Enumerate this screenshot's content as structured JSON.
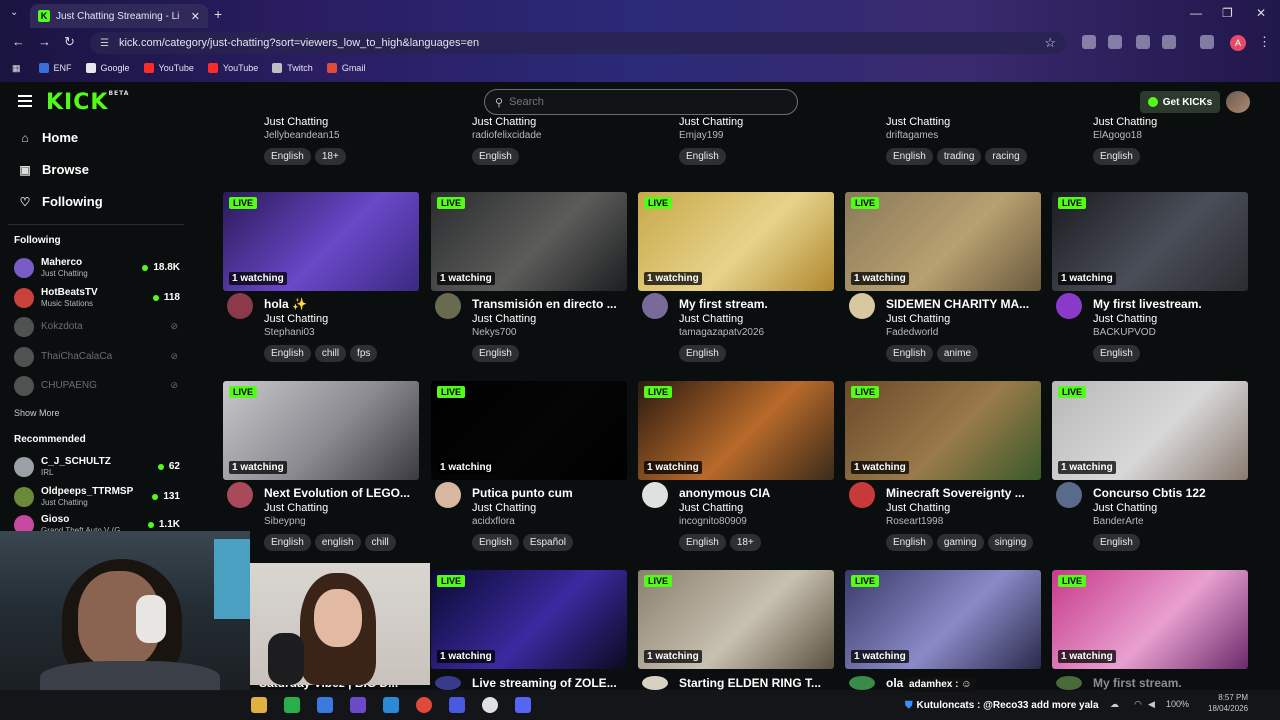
{
  "browser": {
    "tab_title": "Just Chatting Streaming - Li",
    "url": "kick.com/category/just-chatting?sort=viewers_low_to_high&languages=en",
    "bookmarks": [
      {
        "label": "ENF",
        "color": "#3b6fd8"
      },
      {
        "label": "Google",
        "color": "#e8e8e8"
      },
      {
        "label": "YouTube",
        "color": "#ff2a2a"
      },
      {
        "label": "YouTube",
        "color": "#ff2a2a"
      },
      {
        "label": "Twitch",
        "color": "#c0c0c0"
      },
      {
        "label": "Gmail",
        "color": "#e04a3a"
      }
    ],
    "profile_initial": "A"
  },
  "header": {
    "logo": "KICK",
    "logo_sup": "BETA",
    "search_placeholder": "Search",
    "get_kicks": "Get KICKs"
  },
  "sidebar": {
    "nav": [
      {
        "label": "Home",
        "icon": "home-icon",
        "glyph": "⌂"
      },
      {
        "label": "Browse",
        "icon": "browse-icon",
        "glyph": "▣"
      },
      {
        "label": "Following",
        "icon": "heart-icon",
        "glyph": "♡"
      }
    ],
    "following_title": "Following",
    "following": [
      {
        "name": "Maherco",
        "category": "Just Chatting",
        "viewers": "18.8K",
        "online": true,
        "color": "#7a5cc8"
      },
      {
        "name": "HotBeatsTV",
        "category": "Music Stations",
        "viewers": "118",
        "online": true,
        "color": "#c8413a"
      },
      {
        "name": "Kokzdota",
        "category": "",
        "viewers": "",
        "online": false,
        "color": "#8a8a8a"
      },
      {
        "name": "ThaiChaCalaCa",
        "category": "",
        "viewers": "",
        "online": false,
        "color": "#8a8a8a"
      },
      {
        "name": "CHUPAENG",
        "category": "",
        "viewers": "",
        "online": false,
        "color": "#8a8a8a"
      }
    ],
    "show_more": "Show More",
    "recommended_title": "Recommended",
    "recommended": [
      {
        "name": "C_J_SCHULTZ",
        "category": "IRL",
        "viewers": "62",
        "color": "#9aa0a6"
      },
      {
        "name": "Oldpeeps_TTRMSP",
        "category": "Just Chatting",
        "viewers": "131",
        "color": "#6a8a3a"
      },
      {
        "name": "Gioso",
        "category": "Grand Theft Auto V (G",
        "viewers": "1.1K",
        "color": "#c84aa0"
      }
    ]
  },
  "top_row": [
    {
      "category": "Just Chatting",
      "user": "Jellybeandean15",
      "tags": [
        "English",
        "18+"
      ]
    },
    {
      "category": "Just Chatting",
      "user": "radiofelixcidade",
      "tags": [
        "English"
      ]
    },
    {
      "category": "Just Chatting",
      "user": "Emjay199",
      "tags": [
        "English"
      ]
    },
    {
      "category": "Just Chatting",
      "user": "driftagames",
      "tags": [
        "English",
        "trading",
        "racing"
      ]
    },
    {
      "category": "Just Chatting",
      "user": "ElAgogo18",
      "tags": [
        "English"
      ]
    }
  ],
  "rows": [
    [
      {
        "title": "hola ✨",
        "category": "Just Chatting",
        "user": "Stephani03",
        "tags": [
          "English",
          "chill",
          "fps"
        ],
        "watching": "1 watching",
        "thumb": [
          "#2a1a5a",
          "#6a48c8",
          "#3a2a80"
        ],
        "avatar": "#8a3a4a"
      },
      {
        "title": "Transmisión en directo ...",
        "category": "Just Chatting",
        "user": "Nekys700",
        "tags": [
          "English"
        ],
        "watching": "1 watching",
        "thumb": [
          "#2a2c2e",
          "#5c5c5a",
          "#1c1e20"
        ],
        "avatar": "#6a6a50"
      },
      {
        "title": "My first stream.",
        "category": "Just Chatting",
        "user": "tamagazapatv2026",
        "tags": [
          "English"
        ],
        "watching": "1 watching",
        "thumb": [
          "#c8a84a",
          "#e6d38a",
          "#b08830"
        ],
        "avatar": "#7a6a9a"
      },
      {
        "title": "SIDEMEN CHARITY MA...",
        "category": "Just Chatting",
        "user": "Fadedworld",
        "tags": [
          "English",
          "anime"
        ],
        "watching": "1 watching",
        "thumb": [
          "#8a7a5a",
          "#b8a070",
          "#6a5a40"
        ],
        "avatar": "#d8c8a0"
      },
      {
        "title": "My first livestream.",
        "category": "Just Chatting",
        "user": "BACKUPVOD",
        "tags": [
          "English"
        ],
        "watching": "1 watching",
        "thumb": [
          "#1a1c20",
          "#4a4e58",
          "#2a2c30"
        ],
        "avatar": "#8a3ac8"
      }
    ],
    [
      {
        "title": "Next Evolution of LEGO...",
        "category": "Just Chatting",
        "user": "Sibeypng",
        "tags": [
          "English",
          "english",
          "chill"
        ],
        "watching": "1 watching",
        "thumb": [
          "#c8c8cc",
          "#8a8a90",
          "#3a3a40"
        ],
        "avatar": "#a84a5a"
      },
      {
        "title": "Putica punto cum",
        "category": "Just Chatting",
        "user": "acidxflora",
        "tags": [
          "English",
          "Español"
        ],
        "watching": "1 watching",
        "thumb": [
          "#000000",
          "#050505",
          "#000000"
        ],
        "avatar": "#d8b8a0"
      },
      {
        "title": "anonymous CIA",
        "category": "Just Chatting",
        "user": "incognito80909",
        "tags": [
          "English",
          "18+"
        ],
        "watching": "1 watching",
        "thumb": [
          "#2a1a10",
          "#b86a2a",
          "#3a2a1a"
        ],
        "avatar": "#e0e0e0"
      },
      {
        "title": "Minecraft Sovereignty ...",
        "category": "Just Chatting",
        "user": "Roseart1998",
        "tags": [
          "English",
          "gaming",
          "singing"
        ],
        "watching": "1 watching",
        "thumb": [
          "#6a4a2a",
          "#9a7a4a",
          "#3a5a2a"
        ],
        "avatar": "#c83a3a"
      },
      {
        "title": "Concurso Cbtis 122",
        "category": "Just Chatting",
        "user": "BanderArte",
        "tags": [
          "English"
        ],
        "watching": "1 watching",
        "thumb": [
          "#b8b8b8",
          "#d8d8d8",
          "#8a7a70"
        ],
        "avatar": "#5a6a8a"
      }
    ],
    [
      {
        "title": "Saturday Vibez | BIG D...",
        "category": "",
        "user": "",
        "tags": [],
        "watching": "",
        "thumb": [
          "#d0ccc8",
          "#c0b8b0",
          "#a8a0a0"
        ],
        "avatar": "#a0a0a0"
      },
      {
        "title": "Live streaming of ZOLE...",
        "category": "",
        "user": "",
        "tags": [],
        "watching": "1 watching",
        "thumb": [
          "#0a0a30",
          "#3a2aa0",
          "#0a0a20"
        ],
        "avatar": "#3a3a8a"
      },
      {
        "title": "Starting ELDEN RING T...",
        "category": "",
        "user": "",
        "tags": [],
        "watching": "1 watching",
        "thumb": [
          "#8a8070",
          "#c8c0b0",
          "#5a5040"
        ],
        "avatar": "#d8d0c0"
      },
      {
        "title": "ola",
        "category": "",
        "user": "",
        "tags": [],
        "watching": "1 watching",
        "thumb": [
          "#3a3a6a",
          "#8a8ac8",
          "#2a2a4a"
        ],
        "avatar": "#3a8a4a"
      },
      {
        "title": "My first stream.",
        "category": "",
        "user": "",
        "tags": [],
        "watching": "1 watching",
        "thumb": [
          "#c83a8a",
          "#e8a0d0",
          "#6a2a6a"
        ],
        "avatar": "#4a6a3a"
      }
    ]
  ],
  "overlay": {
    "chat_user": "adamhex :",
    "chat_line": "Kutuloncats : @Reco33 add more yala",
    "clock_time": "8:57 PM",
    "clock_date": "18/04/2026",
    "battery": "100%"
  }
}
